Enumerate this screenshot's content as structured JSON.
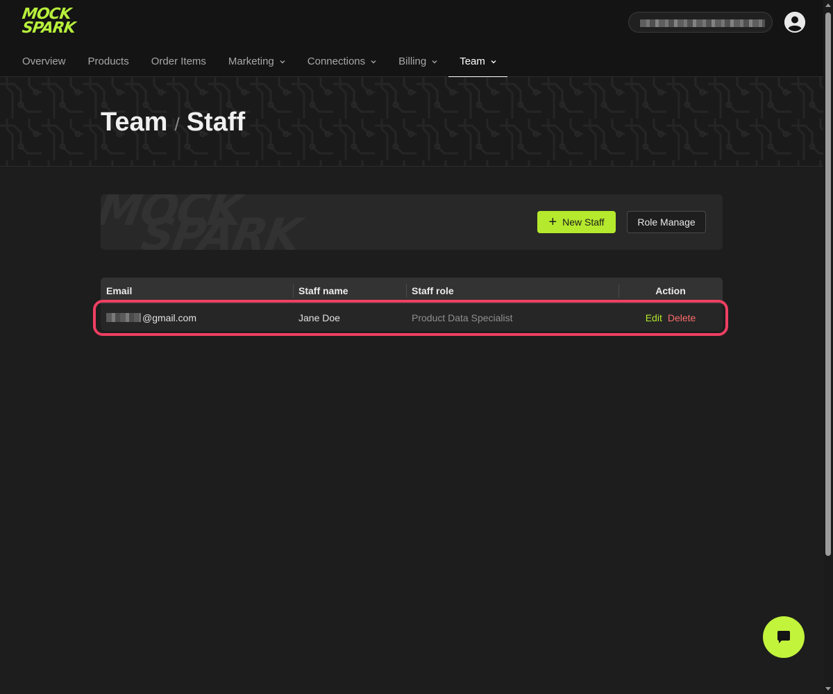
{
  "app": {
    "logo_line1": "MOCK",
    "logo_line2": "SPARK",
    "accent": "#b5e92d",
    "danger": "#ff6b6b",
    "highlight": "#ef3f62"
  },
  "header": {
    "search_icon": "none",
    "user_icon": "user-circle-icon"
  },
  "nav": {
    "items": [
      {
        "label": "Overview",
        "dropdown": false,
        "active": false
      },
      {
        "label": "Products",
        "dropdown": false,
        "active": false
      },
      {
        "label": "Order Items",
        "dropdown": false,
        "active": false
      },
      {
        "label": "Marketing",
        "dropdown": true,
        "active": false
      },
      {
        "label": "Connections",
        "dropdown": true,
        "active": false
      },
      {
        "label": "Billing",
        "dropdown": true,
        "active": false
      },
      {
        "label": "Team",
        "dropdown": true,
        "active": true
      }
    ]
  },
  "breadcrumb": {
    "parent": "Team",
    "separator": "/",
    "current": "Staff"
  },
  "actions": {
    "new_staff": "New Staff",
    "role_manage": "Role Manage"
  },
  "table": {
    "columns": [
      "Email",
      "Staff name",
      "Staff role",
      "Action"
    ],
    "rows": [
      {
        "email_suffix": "@gmail.com",
        "staff_name": "Jane Doe",
        "staff_role": "Product Data Specialist",
        "edit": "Edit",
        "delete": "Delete"
      }
    ]
  },
  "chat": {
    "icon": "chat-bubble-icon"
  }
}
